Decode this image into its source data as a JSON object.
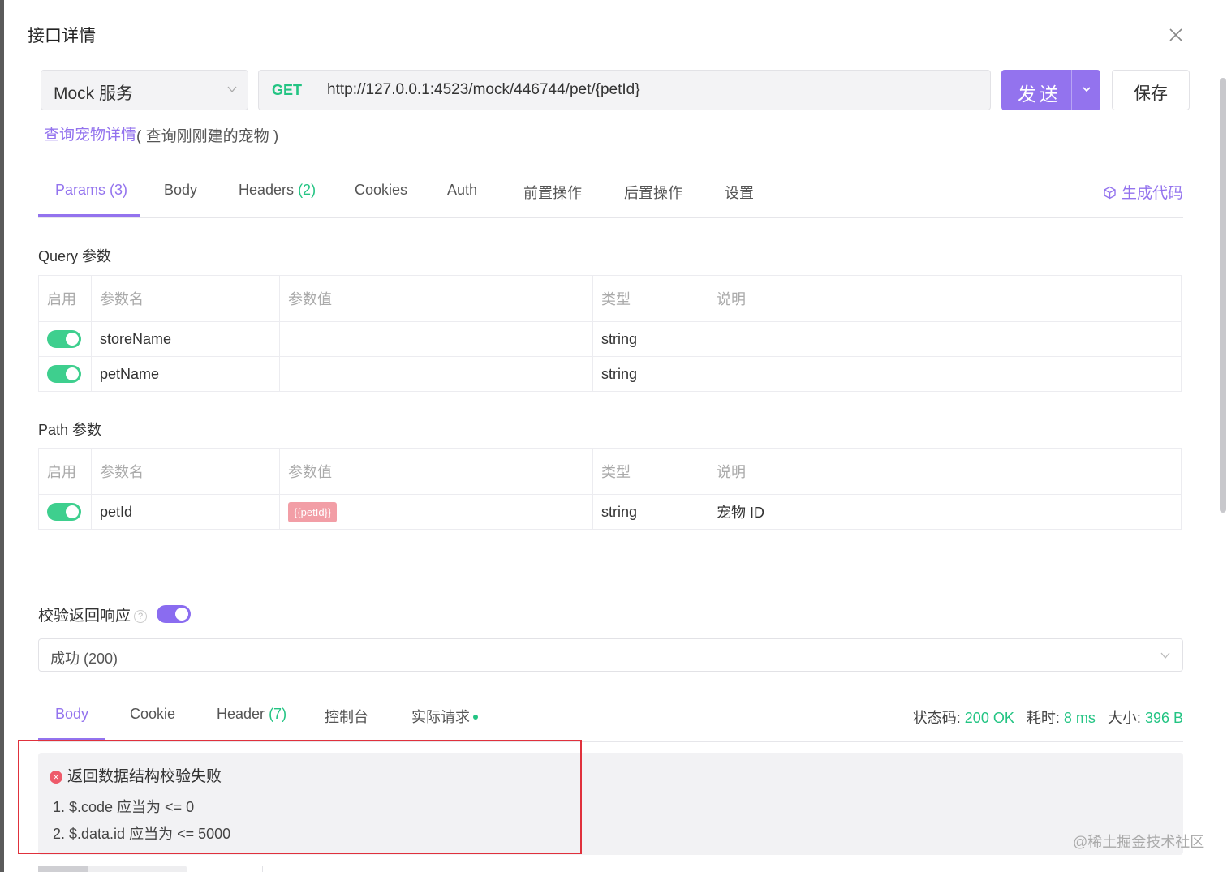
{
  "dialog": {
    "title": "接口详情"
  },
  "request": {
    "service": "Mock 服务",
    "method": "GET",
    "url": "http://127.0.0.1:4523/mock/446744/pet/{petId}",
    "send_label": "发送",
    "save_label": "保存",
    "api_name": "查询宠物详情",
    "api_desc": "( 查询刚刚建的宠物 )"
  },
  "tabs": {
    "params": {
      "label": "Params",
      "count": "(3)"
    },
    "body": {
      "label": "Body"
    },
    "headers": {
      "label": "Headers",
      "count": "(2)"
    },
    "cookies": {
      "label": "Cookies"
    },
    "auth": {
      "label": "Auth"
    },
    "pre": {
      "label": "前置操作"
    },
    "post": {
      "label": "后置操作"
    },
    "settings": {
      "label": "设置"
    },
    "gen_code": "生成代码"
  },
  "query": {
    "title": "Query 参数",
    "columns": [
      "启用",
      "参数名",
      "参数值",
      "类型",
      "说明"
    ],
    "rows": [
      {
        "enabled": true,
        "name": "storeName",
        "value": "",
        "type": "string",
        "desc": ""
      },
      {
        "enabled": true,
        "name": "petName",
        "value": "",
        "type": "string",
        "desc": ""
      }
    ]
  },
  "path": {
    "title": "Path 参数",
    "columns": [
      "启用",
      "参数名",
      "参数值",
      "类型",
      "说明"
    ],
    "rows": [
      {
        "enabled": true,
        "name": "petId",
        "value": "{{petId}}",
        "type": "string",
        "desc": "宠物 ID"
      }
    ]
  },
  "validate": {
    "label": "校验返回响应",
    "enabled": true,
    "response": "成功 (200)"
  },
  "response_tabs": {
    "body": "Body",
    "cookie": "Cookie",
    "header": {
      "label": "Header",
      "count": "(7)"
    },
    "console": "控制台",
    "actual": "实际请求"
  },
  "status": {
    "code_label": "状态码:",
    "code_value": "200 OK",
    "time_label": "耗时:",
    "time_value": "8 ms",
    "size_label": "大小:",
    "size_value": "396 B"
  },
  "error": {
    "title": "返回数据结构校验失败",
    "lines": [
      "1. $.code 应当为 <= 0",
      "2. $.data.id 应当为 <= 5000"
    ]
  },
  "watermark": "@稀土掘金技术社区",
  "colors": {
    "accent": "#9373ee",
    "success": "#23c483",
    "error": "#ee5a6a",
    "highlight_box": "#e0313c"
  }
}
